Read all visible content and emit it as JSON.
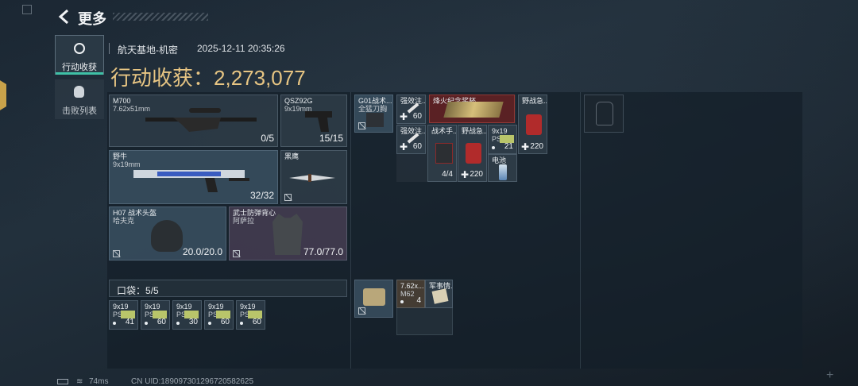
{
  "header": {
    "title": "更多"
  },
  "tabs": [
    {
      "label": "行动收获"
    },
    {
      "label": "击败列表"
    }
  ],
  "match": {
    "map": "航天基地-机密",
    "datetime": "2025-12-11 20:35:26",
    "earnings_label": "行动收获：",
    "earnings_value": "2,273,077"
  },
  "weapons": {
    "primary": {
      "name": "M700",
      "ammo": "7.62x51mm",
      "count": "0/5"
    },
    "pistol": {
      "name": "QSZ92G",
      "ammo": "9x19mm",
      "count": "15/15"
    },
    "secondary": {
      "name": "野牛",
      "ammo": "9x19mm",
      "count": "32/32"
    },
    "melee": {
      "name": "黑鹰"
    }
  },
  "armor": {
    "helmet": {
      "name": "H07 战术头盔",
      "brand": "哈夫克",
      "durability": "20.0/20.0"
    },
    "vest": {
      "name": "武士防弹背心",
      "brand": "阿萨拉",
      "durability": "77.0/77.0"
    }
  },
  "pocket": {
    "label": "口袋：",
    "capacity": "5/5",
    "items": [
      {
        "name": "9x19",
        "sub": "PSO",
        "count": "41"
      },
      {
        "name": "9x19",
        "sub": "PSO",
        "count": "60"
      },
      {
        "name": "9x19",
        "sub": "PSO",
        "count": "30"
      },
      {
        "name": "9x19",
        "sub": "PSO",
        "count": "60"
      },
      {
        "name": "9x19",
        "sub": "PSO",
        "count": "60"
      }
    ]
  },
  "rig": {
    "items": [
      {
        "name": "G01战术...",
        "sub": "全猛刀胸"
      },
      {
        "name": "强效注...",
        "count": "60"
      },
      {
        "name": "强效注...",
        "count": "60"
      },
      {
        "name": "烽火纪念奖杯"
      },
      {
        "name": "野战急...",
        "count": "220"
      },
      {
        "name": "战术手...",
        "count": "4/4"
      },
      {
        "name": "野战急...",
        "count": "220"
      },
      {
        "name": "9x19",
        "sub": "PS",
        "count": "21"
      },
      {
        "name": "电池"
      }
    ]
  },
  "backpack2": {
    "items": [
      {
        "name": "7.62x...",
        "sub": "M62",
        "count": "4"
      },
      {
        "name": "军事情..."
      }
    ]
  },
  "status": {
    "ping": "74ms",
    "uid": "CN UID:1890973012967205826​25"
  }
}
